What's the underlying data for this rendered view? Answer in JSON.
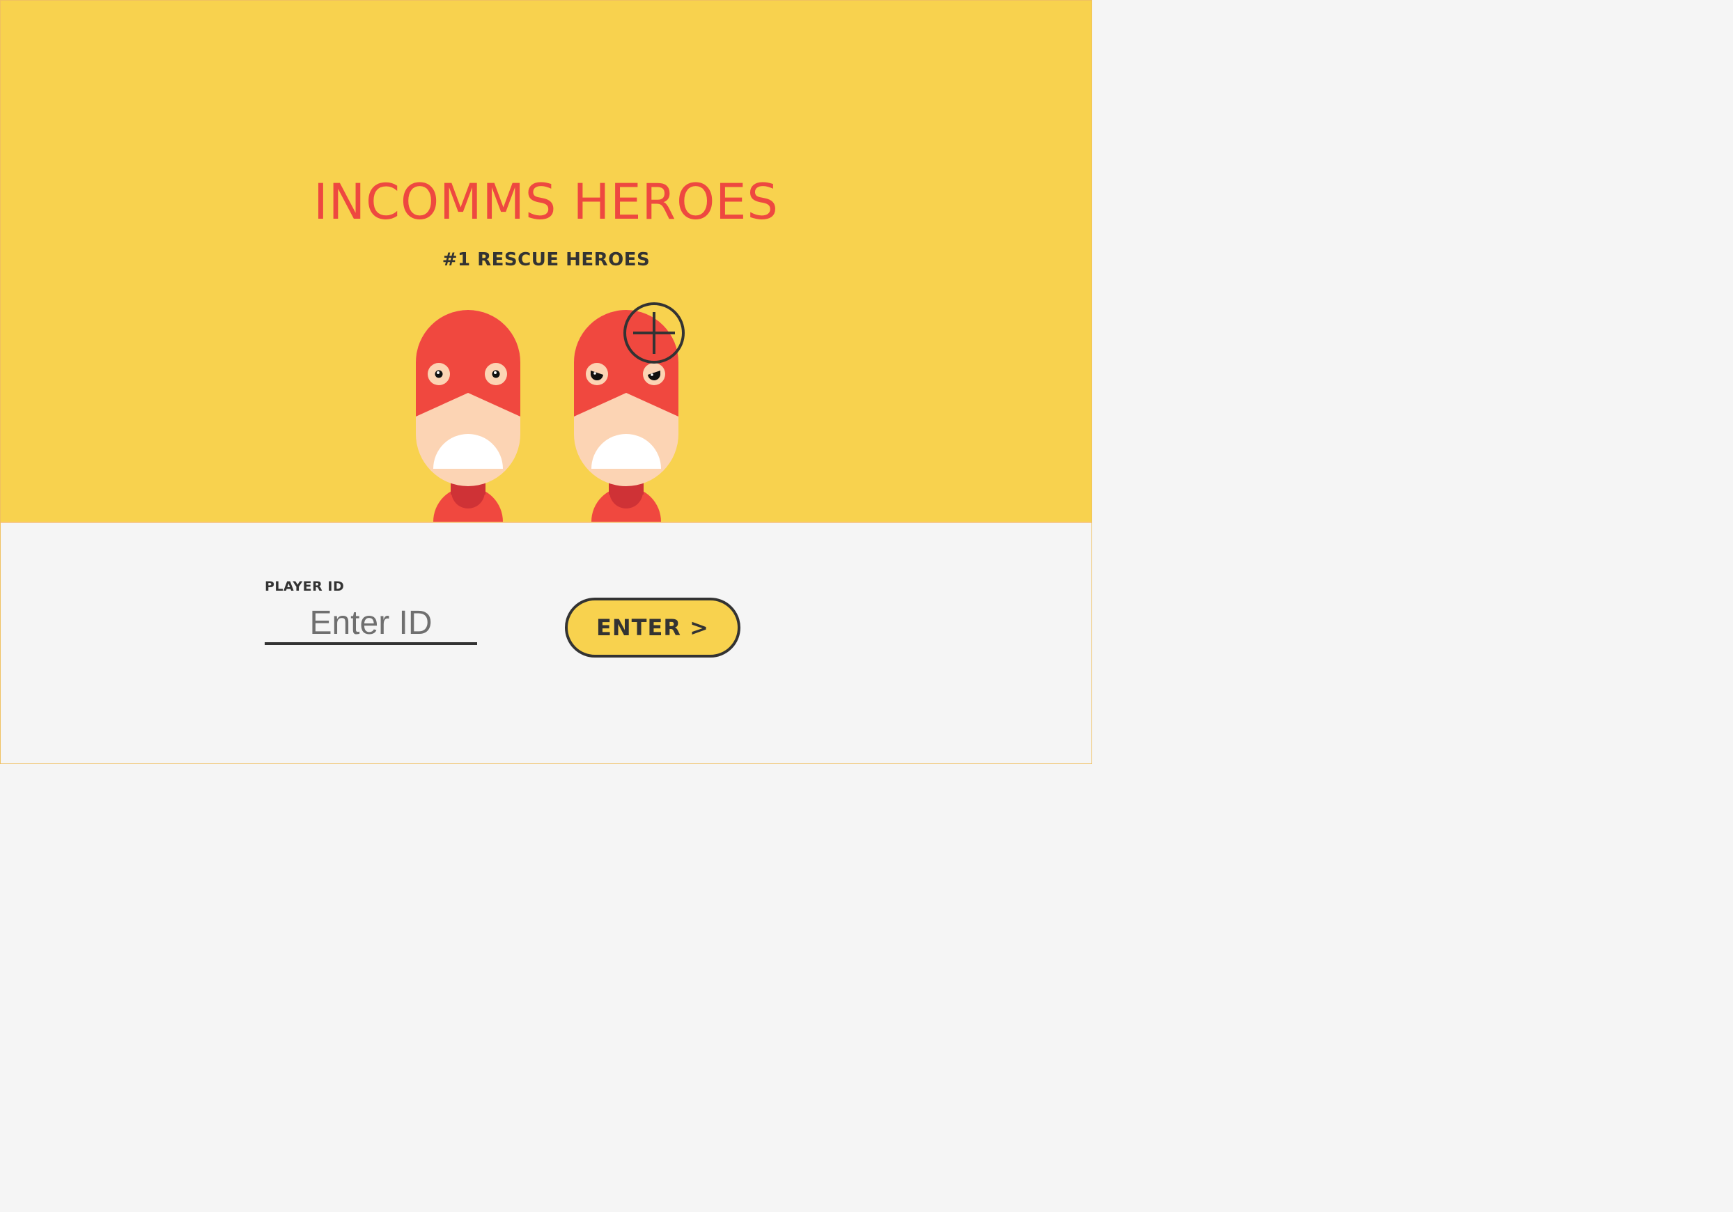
{
  "header": {
    "title": "INCOMMS HEROES",
    "subtitle": "#1 RESCUE HEROES"
  },
  "heroes": [
    {
      "name": "hero-left",
      "expression": "neutral"
    },
    {
      "name": "hero-right",
      "expression": "angry",
      "overlay_icon": "crosshair-icon"
    }
  ],
  "form": {
    "player_id_label": "PLAYER ID",
    "player_id_placeholder": "Enter ID",
    "player_id_value": "",
    "enter_button_label": "ENTER >"
  },
  "colors": {
    "background_top": "#f8d24e",
    "background_bottom": "#f5f5f5",
    "title": "#ee4840",
    "hero_red": "#f0483f",
    "hero_skin": "#fcd4b4",
    "dark": "#333333"
  }
}
